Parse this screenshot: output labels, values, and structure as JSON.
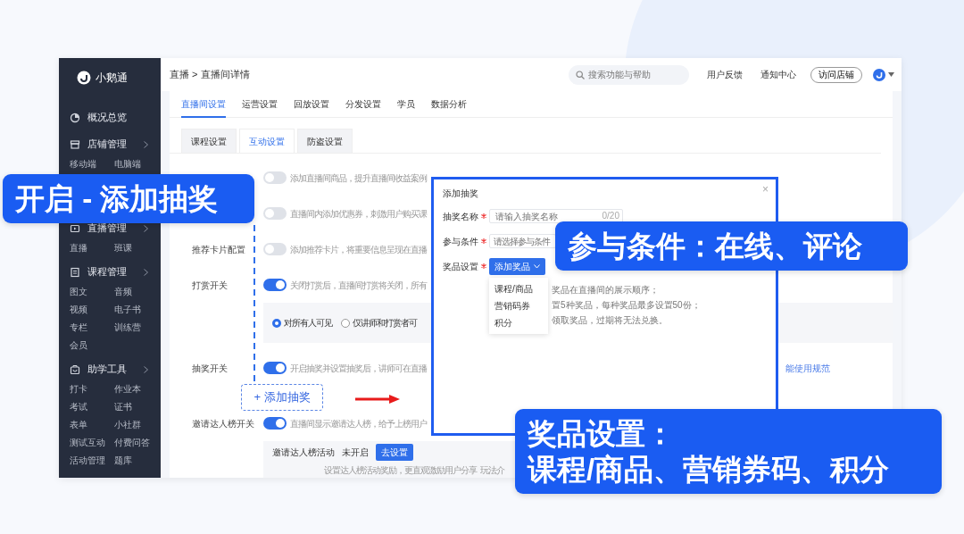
{
  "app": {
    "logo": "小鹅通",
    "sidebar": [
      {
        "kind": "link",
        "label": "概况总览"
      },
      {
        "kind": "group",
        "label": "店铺管理",
        "children": [
          "移动端",
          "电脑端"
        ]
      },
      {
        "kind": "group",
        "label": "直播管理",
        "children": [
          "直播",
          "班课"
        ]
      },
      {
        "kind": "group",
        "label": "课程管理",
        "children": [
          "图文",
          "音频",
          "视频",
          "电子书",
          "专栏",
          "训练营",
          "会员"
        ]
      },
      {
        "kind": "group",
        "label": "助学工具",
        "children": [
          "打卡",
          "作业本",
          "考试",
          "证书",
          "表单",
          "小社群",
          "测试互动",
          "付费问答",
          "活动管理",
          "题库"
        ]
      }
    ],
    "breadcrumb": "直播 > 直播间详情",
    "search": {
      "placeholder": "搜索功能与帮助"
    },
    "header_links": [
      "用户反馈",
      "通知中心"
    ],
    "visit_button": "访问店铺",
    "tabs": [
      {
        "label": "直播间设置",
        "selected": true
      },
      {
        "label": "运营设置",
        "selected": false
      },
      {
        "label": "回放设置",
        "selected": false
      },
      {
        "label": "分发设置",
        "selected": false
      },
      {
        "label": "学员",
        "selected": false
      },
      {
        "label": "数据分析",
        "selected": false
      }
    ],
    "subtabs": [
      {
        "label": "课程设置",
        "selected": false
      },
      {
        "label": "互动设置",
        "selected": true
      },
      {
        "label": "防盗设置",
        "selected": false
      }
    ],
    "settings": [
      {
        "kind": "toggle",
        "on": false,
        "description": "添加直播间商品，提升直播间收益案例"
      },
      {
        "kind": "toggle",
        "on": false,
        "description": "直播间内添加优惠券，刺激用户购买课"
      },
      {
        "kind": "toggle",
        "label": "推荐卡片配置",
        "on": false,
        "description": "添加推荐卡片，将重要信息呈现在直播"
      },
      {
        "kind": "toggle",
        "label": "打赏开关",
        "on": true,
        "description": "关闭打赏后，直播间打赏将关闭，所有"
      },
      {
        "kind": "radios",
        "options": [
          {
            "label": "对所有人可见",
            "selected": true
          },
          {
            "label": "仅讲师和打赏者可",
            "selected": false
          }
        ]
      },
      {
        "kind": "toggle",
        "label": "抽奖开关",
        "on": true,
        "description": "开启抽奖并设置抽奖后，讲师可在直播",
        "link": "能使用规范"
      },
      {
        "kind": "add_button",
        "label": "+ 添加抽奖"
      },
      {
        "kind": "toggle",
        "label": "邀请达人榜开关",
        "on": true,
        "description": "直播间显示邀请达人榜，给予上榜用户"
      },
      {
        "kind": "invite_box",
        "title": "邀请达人榜活动",
        "status": "未开启",
        "button": "去设置",
        "note": "设置达人榜活动奖励，更直观激励用户分享",
        "link": "玩法介"
      }
    ]
  },
  "dialog": {
    "title": "添加抽奖",
    "close": "×",
    "fields": [
      {
        "kind": "input",
        "label": "抽奖名称",
        "required": true,
        "placeholder": "请输入抽奖名称",
        "counter": "0/20"
      },
      {
        "kind": "select",
        "label": "参与条件",
        "required": true,
        "placeholder": "请选择参与条件"
      },
      {
        "kind": "button",
        "label": "奖品设置",
        "required": true,
        "button": "添加奖品"
      }
    ],
    "menu": [
      "课程/商品",
      "营销码券",
      "积分"
    ],
    "notes": [
      "奖品在直播间的展示顺序；",
      "置5种奖品，每种奖品最多设置50份；",
      "领取奖品，过期将无法兑换。"
    ]
  },
  "callouts": [
    {
      "lines": [
        "开启 - 添加抽奖"
      ]
    },
    {
      "lines": [
        "参与条件：在线、评论"
      ]
    },
    {
      "lines": [
        "奖品设置：",
        "课程/商品、营销券码、积分"
      ]
    }
  ]
}
